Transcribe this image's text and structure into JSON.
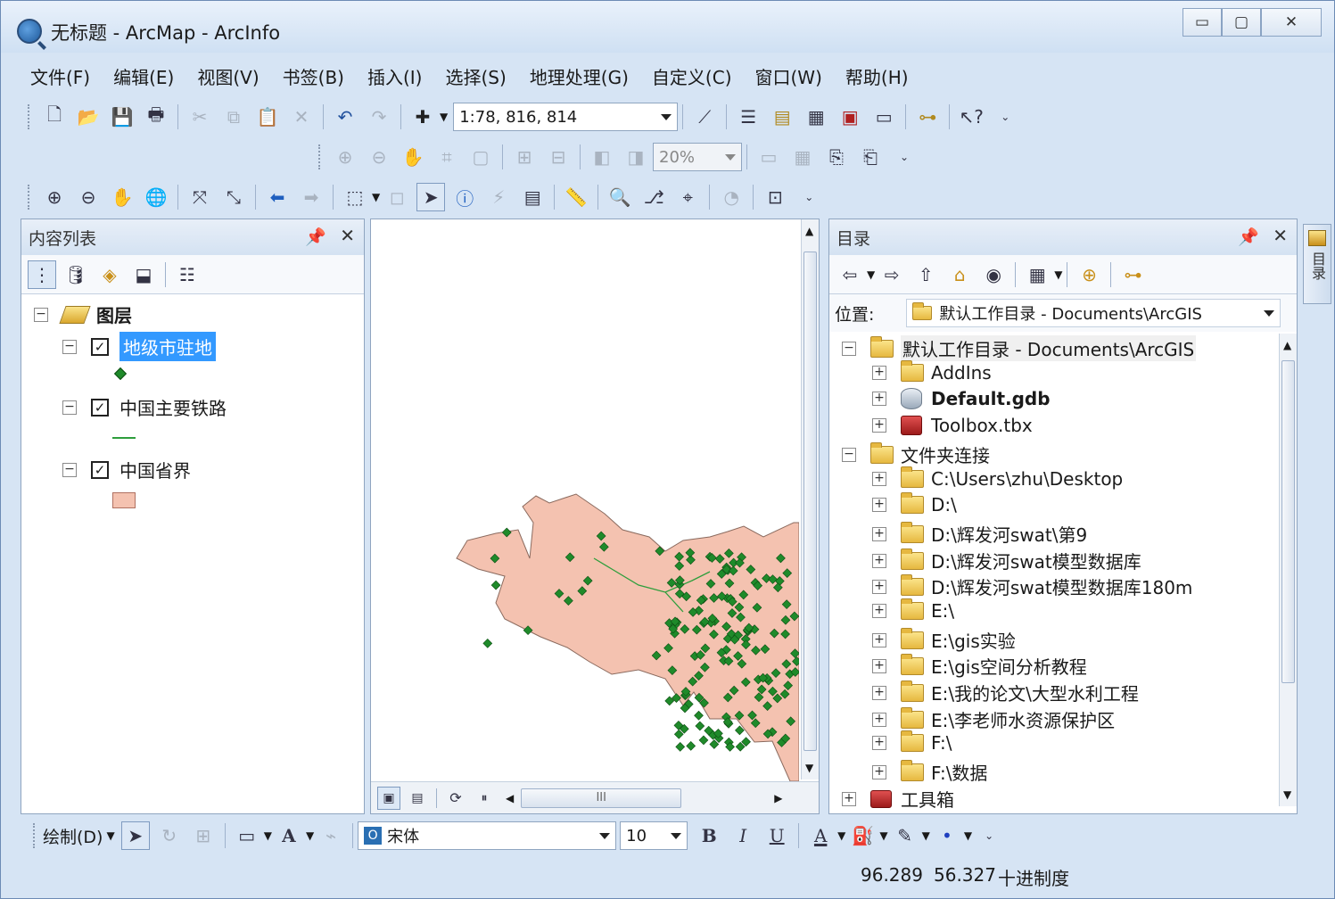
{
  "window": {
    "title": "无标题 - ArcMap - ArcInfo",
    "minimize": "▭",
    "maximize": "▢",
    "close": "✕"
  },
  "menu": [
    "文件(F)",
    "编辑(E)",
    "视图(V)",
    "书签(B)",
    "插入(I)",
    "选择(S)",
    "地理处理(G)",
    "自定义(C)",
    "窗口(W)",
    "帮助(H)"
  ],
  "toolbar": {
    "scale": "1:78, 816, 814",
    "zoom_percent": "20%",
    "help_glyph": "?"
  },
  "toc": {
    "title": "内容列表",
    "root": "图层",
    "layers": [
      {
        "name": "地级市驻地",
        "checked": true,
        "selected": true,
        "symbol": "point"
      },
      {
        "name": "中国主要铁路",
        "checked": true,
        "selected": false,
        "symbol": "line"
      },
      {
        "name": "中国省界",
        "checked": true,
        "selected": false,
        "symbol": "polygon"
      }
    ]
  },
  "catalog": {
    "title": "目录",
    "location_label": "位置:",
    "location_value": "默认工作目录 - Documents\\ArcGIS",
    "tree": [
      {
        "label": "默认工作目录 - Documents\\ArcGIS",
        "level": 0,
        "icon": "home-folder",
        "expander": "⊟"
      },
      {
        "label": "AddIns",
        "level": 1,
        "icon": "folder",
        "expander": "⊞"
      },
      {
        "label": "Default.gdb",
        "level": 1,
        "icon": "gdb",
        "expander": "⊞",
        "bold": true
      },
      {
        "label": "Toolbox.tbx",
        "level": 1,
        "icon": "toolbox",
        "expander": "⊞"
      },
      {
        "label": "文件夹连接",
        "level": 0,
        "icon": "folder-connection",
        "expander": "⊟"
      },
      {
        "label": "C:\\Users\\zhu\\Desktop",
        "level": 1,
        "icon": "folder",
        "expander": "⊞"
      },
      {
        "label": "D:\\",
        "level": 1,
        "icon": "folder",
        "expander": "⊞"
      },
      {
        "label": "D:\\辉发河swat\\第9",
        "level": 1,
        "icon": "folder",
        "expander": "⊞"
      },
      {
        "label": "D:\\辉发河swat模型数据库",
        "level": 1,
        "icon": "folder",
        "expander": "⊞"
      },
      {
        "label": "D:\\辉发河swat模型数据库180m",
        "level": 1,
        "icon": "folder",
        "expander": "⊞"
      },
      {
        "label": "E:\\",
        "level": 1,
        "icon": "folder",
        "expander": "⊞"
      },
      {
        "label": "E:\\gis实验",
        "level": 1,
        "icon": "folder",
        "expander": "⊞"
      },
      {
        "label": "E:\\gis空间分析教程",
        "level": 1,
        "icon": "folder",
        "expander": "⊞"
      },
      {
        "label": "E:\\我的论文\\大型水利工程",
        "level": 1,
        "icon": "folder",
        "expander": "⊞"
      },
      {
        "label": "E:\\李老师水资源保护区",
        "level": 1,
        "icon": "folder",
        "expander": "⊞"
      },
      {
        "label": "F:\\",
        "level": 1,
        "icon": "folder",
        "expander": "⊞"
      },
      {
        "label": "F:\\数据",
        "level": 1,
        "icon": "folder",
        "expander": "⊞"
      },
      {
        "label": "工具箱",
        "level": 0,
        "icon": "toolbox-folder",
        "expander": "⊞"
      }
    ],
    "side_tab": "目录"
  },
  "draw_toolbar": {
    "draw_label": "绘制(D)",
    "font": "宋体",
    "font_size": "10",
    "bold": "B",
    "italic": "I",
    "underline": "U",
    "font_color_glyph": "A"
  },
  "map": {
    "hscroll_label": "III"
  },
  "status": {
    "x": "96.289",
    "y": "56.327",
    "units": "十进制度"
  },
  "colors": {
    "accent": "#3399ff",
    "province_fill": "#f4c2b0",
    "city_point": "#1f8a2a",
    "railway": "#2e9e3c"
  }
}
